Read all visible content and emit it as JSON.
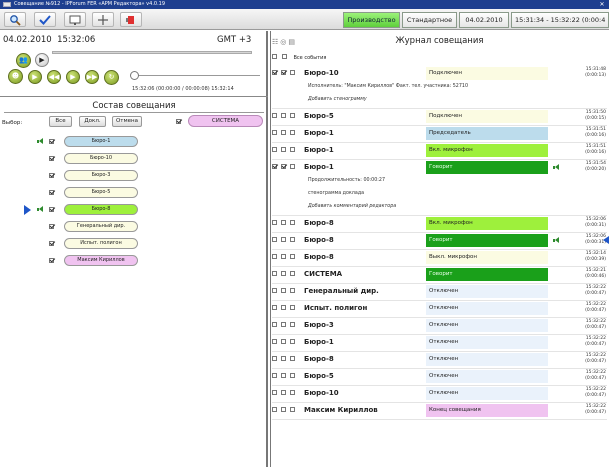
{
  "window": {
    "title": "Совещание №912 - IPForum FER «АРМ Редактора» v4.0.19",
    "close": "✕"
  },
  "toolbar": {
    "icons": [
      "search-icon",
      "check-icon",
      "monitor-icon",
      "split-icon",
      "stop-icon"
    ],
    "segments": [
      {
        "label": "Производство",
        "active": true
      },
      {
        "label": "Стандартное",
        "active": false
      },
      {
        "label": "04.02.2010",
        "active": false
      },
      {
        "label": "15:31:34 - 15:32:22  (0:00:4",
        "active": false
      }
    ]
  },
  "player": {
    "date": "04.02.2010",
    "time": "15:32:06",
    "gmt": "GMT +3",
    "times": "15:32:06   (00:00:00 / 00:00:08)   15:32:14",
    "buttons": [
      "record-people",
      "play",
      "rewind",
      "play-forward",
      "fast-forward",
      "loop"
    ]
  },
  "composition": {
    "title": "Состав совещания",
    "select_label": "Выбор:",
    "buttons": [
      "Все",
      "Докл.",
      "Отмена"
    ],
    "system_label": "СИСТЕМА",
    "participants": [
      {
        "name": "Бюро-1",
        "color": "#bcdcec",
        "checked": true,
        "speaker": true,
        "pointer": false
      },
      {
        "name": "Бюро-10",
        "color": "#fbfbe2",
        "checked": true,
        "speaker": false,
        "pointer": false
      },
      {
        "name": "Бюро-3",
        "color": "#fbfbe2",
        "checked": true,
        "speaker": false,
        "pointer": false
      },
      {
        "name": "Бюро-5",
        "color": "#fbfbe2",
        "checked": true,
        "speaker": false,
        "pointer": false
      },
      {
        "name": "Бюро-8",
        "color": "#9ef03c",
        "checked": true,
        "speaker": true,
        "pointer": true
      },
      {
        "name": "Генеральный дир.",
        "color": "#fbfbe2",
        "checked": true,
        "speaker": false,
        "pointer": false
      },
      {
        "name": "Испыт. полигон",
        "color": "#fbfbe2",
        "checked": true,
        "speaker": false,
        "pointer": false
      },
      {
        "name": "Максим Кириллов",
        "color": "#f0c3f0",
        "checked": true,
        "speaker": false,
        "pointer": false
      }
    ]
  },
  "log": {
    "title": "Журнал совещания",
    "all_events": "Все события",
    "entries": [
      {
        "who": "Бюро-10",
        "status": "Подключен",
        "color": "#fbfbe2",
        "time": "15:31:48",
        "dur": "(0:00:13)",
        "checked": true,
        "speaker": false,
        "pointer": false,
        "notes": [
          {
            "text": "Исполнитель: \"Максим Кириллов\" Факт. тел. участника: 52710",
            "italic": false
          },
          {
            "text": "Добавить стенограмму",
            "italic": true
          }
        ]
      },
      {
        "who": "Бюро-5",
        "status": "Подключен",
        "color": "#fbfbe2",
        "time": "15:31:50",
        "dur": "(0:00:15)",
        "checked": false,
        "speaker": false,
        "pointer": false,
        "notes": []
      },
      {
        "who": "Бюро-1",
        "status": "Председатель",
        "color": "#bcdcec",
        "time": "15:31:51",
        "dur": "(0:00:16)",
        "checked": false,
        "speaker": false,
        "pointer": false,
        "notes": []
      },
      {
        "who": "Бюро-1",
        "status": "Вкл. микрофон",
        "color": "#9ef03c",
        "time": "15:31:51",
        "dur": "(0:00:16)",
        "checked": false,
        "speaker": false,
        "pointer": false,
        "notes": []
      },
      {
        "who": "Бюро-1",
        "status": "Говорит",
        "color": "#1aa01a",
        "time": "15:31:54",
        "dur": "(0:00:20)",
        "checked": true,
        "speaker": true,
        "pointer": false,
        "notes": [
          {
            "text": "Продолжительность: 00:00:27",
            "italic": false
          },
          {
            "text": "стенограмма доклада",
            "italic": false
          },
          {
            "text": "Добавить комментарий редактора",
            "italic": true
          }
        ]
      },
      {
        "who": "Бюро-8",
        "status": "Вкл. микрофон",
        "color": "#9ef03c",
        "time": "15:32:06",
        "dur": "(0:00:31)",
        "checked": false,
        "speaker": false,
        "pointer": false,
        "notes": []
      },
      {
        "who": "Бюро-8",
        "status": "Говорит",
        "color": "#1aa01a",
        "time": "15:32:06",
        "dur": "(0:00:31)",
        "checked": false,
        "speaker": true,
        "pointer": true,
        "notes": []
      },
      {
        "who": "Бюро-8",
        "status": "Выкл. микрофон",
        "color": "#fbfbe2",
        "time": "15:32:14",
        "dur": "(0:00:39)",
        "checked": false,
        "speaker": false,
        "pointer": false,
        "notes": []
      },
      {
        "who": "СИСТЕМА",
        "status": "Говорит",
        "color": "#1aa01a",
        "time": "15:32:21",
        "dur": "(0:00:46)",
        "checked": false,
        "speaker": false,
        "pointer": false,
        "notes": []
      },
      {
        "who": "Генеральный дир.",
        "status": "Отключен",
        "color": "#eaf2fb",
        "time": "15:32:22",
        "dur": "(0:00:47)",
        "checked": false,
        "speaker": false,
        "pointer": false,
        "notes": []
      },
      {
        "who": "Испыт. полигон",
        "status": "Отключен",
        "color": "#eaf2fb",
        "time": "15:32:22",
        "dur": "(0:00:47)",
        "checked": false,
        "speaker": false,
        "pointer": false,
        "notes": []
      },
      {
        "who": "Бюро-3",
        "status": "Отключен",
        "color": "#eaf2fb",
        "time": "15:32:22",
        "dur": "(0:00:47)",
        "checked": false,
        "speaker": false,
        "pointer": false,
        "notes": []
      },
      {
        "who": "Бюро-1",
        "status": "Отключен",
        "color": "#eaf2fb",
        "time": "15:32:22",
        "dur": "(0:00:47)",
        "checked": false,
        "speaker": false,
        "pointer": false,
        "notes": []
      },
      {
        "who": "Бюро-8",
        "status": "Отключен",
        "color": "#eaf2fb",
        "time": "15:32:22",
        "dur": "(0:00:47)",
        "checked": false,
        "speaker": false,
        "pointer": false,
        "notes": []
      },
      {
        "who": "Бюро-5",
        "status": "Отключен",
        "color": "#eaf2fb",
        "time": "15:32:22",
        "dur": "(0:00:47)",
        "checked": false,
        "speaker": false,
        "pointer": false,
        "notes": []
      },
      {
        "who": "Бюро-10",
        "status": "Отключен",
        "color": "#eaf2fb",
        "time": "15:32:22",
        "dur": "(0:00:47)",
        "checked": false,
        "speaker": false,
        "pointer": false,
        "notes": []
      },
      {
        "who": "Максим Кириллов",
        "status": "Конец совещания",
        "color": "#f0c3f0",
        "time": "15:32:22",
        "dur": "(0:00:47)",
        "checked": false,
        "speaker": false,
        "pointer": false,
        "notes": []
      }
    ]
  }
}
